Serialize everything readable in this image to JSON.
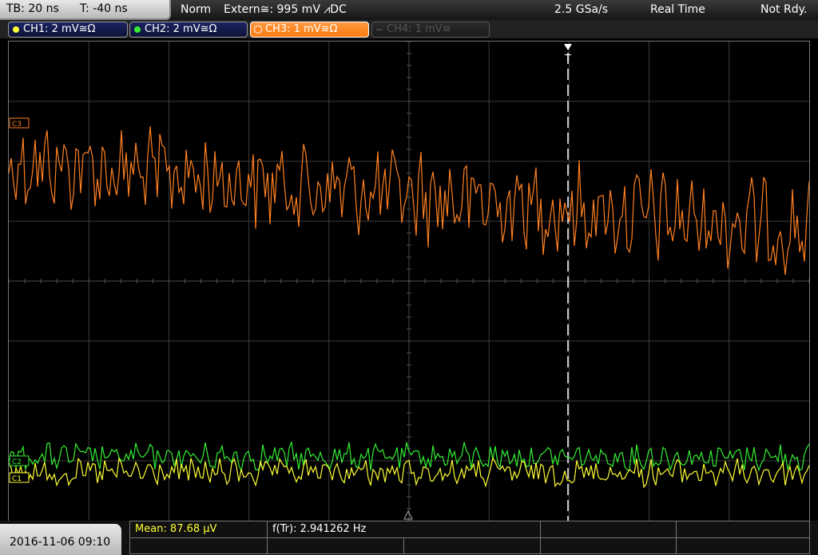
{
  "topbar": {
    "timebase": "TB: 20 ns",
    "trigger_offset": "T: -40 ns",
    "trigger_mode": "Norm",
    "trigger_source": "Extern≅: 995 mV ⩘DC",
    "sample_rate": "2.5 GSa/s",
    "acquisition": "Real Time",
    "status": "Not Rdy."
  },
  "channels": [
    {
      "label": "CH1: 2 mV≅Ω",
      "color": "#ffff33",
      "state": "on"
    },
    {
      "label": "CH2: 2 mV≅Ω",
      "color": "#33ee33",
      "state": "on"
    },
    {
      "label": "CH3: 1 mV≅Ω",
      "color": "#ff8020",
      "state": "selected"
    },
    {
      "label": "CH4: 1 mV≅",
      "color": "#555555",
      "state": "off"
    }
  ],
  "markers": {
    "ch3": "C3",
    "ch2": "C2",
    "ch1": "C1",
    "trigger": "T"
  },
  "measurements": {
    "mean": "Mean: 87.68 µV",
    "freq": "f(Tr): 2.941262 Hz"
  },
  "datetime": "2016-11-06 09:10",
  "colors": {
    "ch1": "#ffff33",
    "ch2": "#33ee33",
    "ch3": "#ff8020",
    "grid": "#3c3c3c"
  }
}
